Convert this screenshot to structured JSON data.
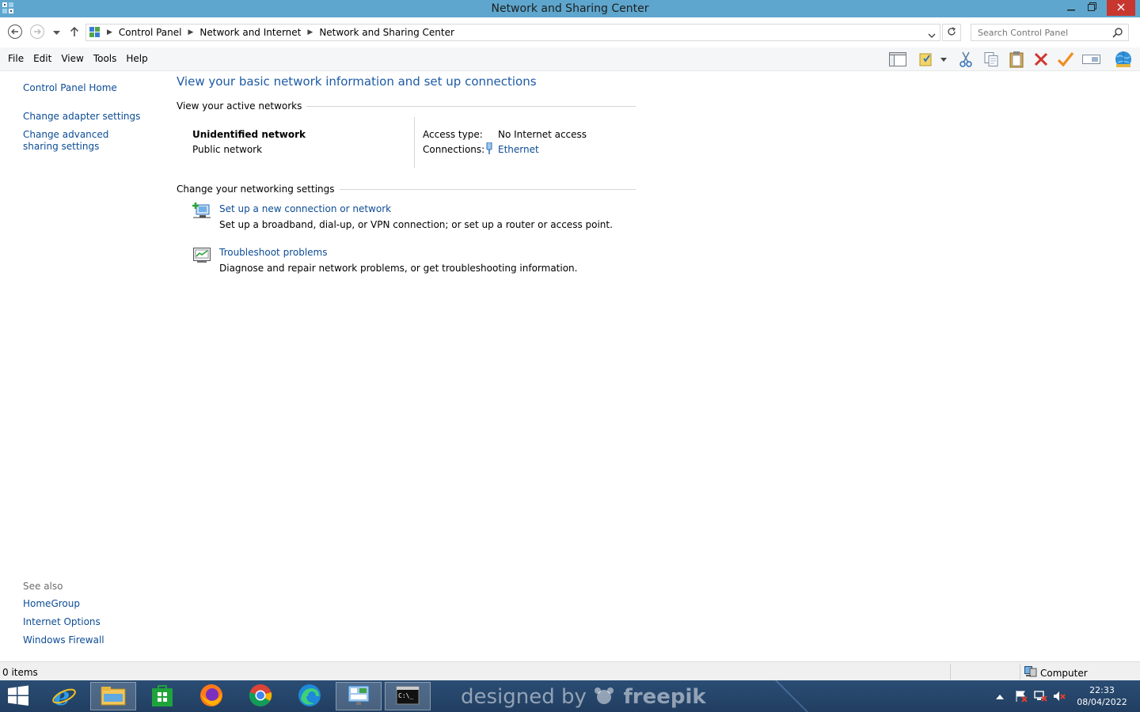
{
  "window": {
    "title": "Network and Sharing Center",
    "controls": [
      "minimize-icon",
      "restore-icon",
      "close-icon"
    ]
  },
  "address": {
    "breadcrumb": [
      "Control Panel",
      "Network and Internet",
      "Network and Sharing Center"
    ],
    "search_placeholder": "Search Control Panel"
  },
  "menu": {
    "items": [
      "File",
      "Edit",
      "View",
      "Tools",
      "Help"
    ]
  },
  "toolbar": {
    "icons": [
      "layout-pane-icon",
      "properties-icon",
      "cut-icon",
      "copy-icon",
      "paste-icon",
      "delete-icon",
      "checkmark-icon",
      "rename-icon",
      "globe-icon"
    ]
  },
  "left": {
    "home": "Control Panel Home",
    "links": [
      "Change adapter settings",
      "Change advanced sharing settings"
    ],
    "see_also_label": "See also",
    "see_also": [
      "HomeGroup",
      "Internet Options",
      "Windows Firewall"
    ]
  },
  "main": {
    "title": "View your basic network information and set up connections",
    "active_networks_label": "View your active networks",
    "network": {
      "name": "Unidentified network",
      "type": "Public network",
      "access_type_label": "Access type:",
      "access_type_value": "No Internet access",
      "connections_label": "Connections:",
      "connections_value": "Ethernet"
    },
    "change_settings_label": "Change your networking settings",
    "tasks": [
      {
        "link": "Set up a new connection or network",
        "desc": "Set up a broadband, dial-up, or VPN connection; or set up a router or access point."
      },
      {
        "link": "Troubleshoot problems",
        "desc": "Diagnose and repair network problems, or get troubleshooting information."
      }
    ]
  },
  "status": {
    "items": "0 items",
    "location": "Computer"
  },
  "taskbar": {
    "watermark_prefix": "designed by",
    "watermark_brand": "freepik",
    "time": "22:33",
    "date": "08/04/2022"
  },
  "colors": {
    "titlebar": "#5ea6cd",
    "link": "#0c4c94",
    "heading": "#1d5aa6",
    "taskbar": "#213e61",
    "close": "#c7372f"
  }
}
